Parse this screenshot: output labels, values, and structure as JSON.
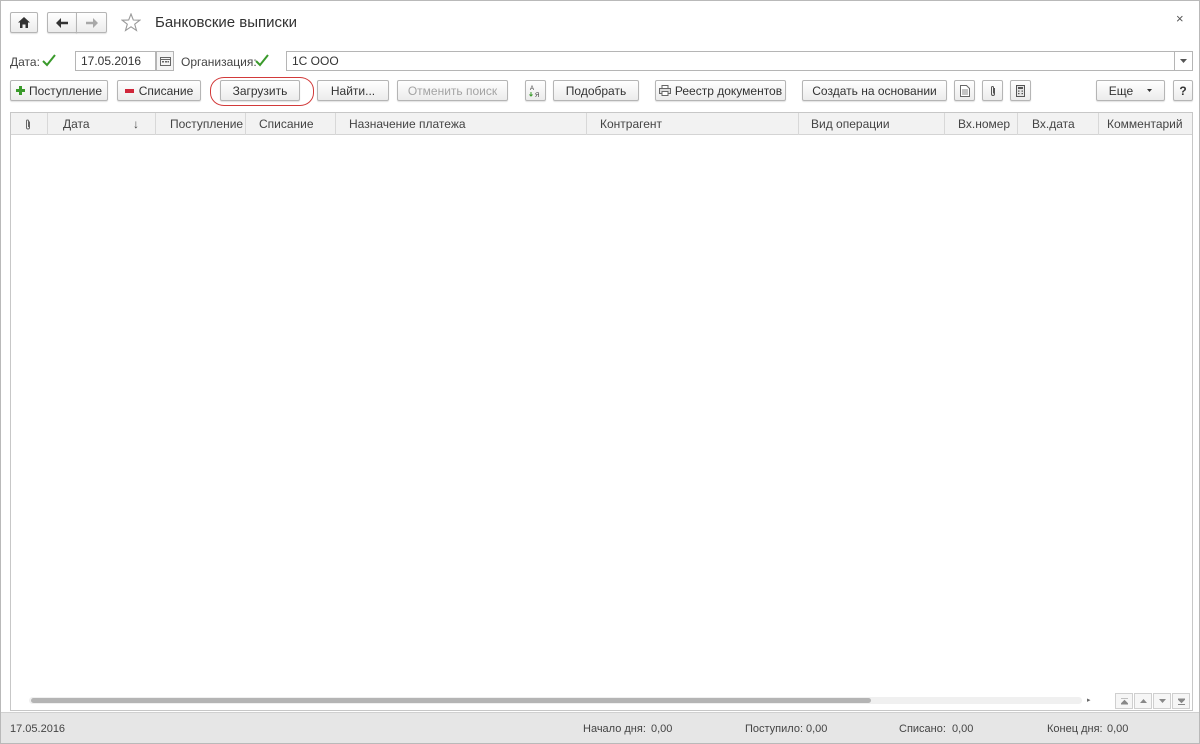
{
  "header": {
    "title": "Банковские выписки",
    "close_symbol": "×"
  },
  "filters": {
    "date_label": "Дата:",
    "date_value": "17.05.2016",
    "org_label": "Организация:",
    "org_value": "1С ООО"
  },
  "toolbar": {
    "income_label": "Поступление",
    "writeoff_label": "Списание",
    "load_label": "Загрузить",
    "find_label": "Найти...",
    "cancel_search_label": "Отменить поиск",
    "select_label": "Подобрать",
    "registry_label": "Реестр документов",
    "create_based_label": "Создать на основании",
    "more_label": "Еще",
    "help_label": "?"
  },
  "table": {
    "columns": [
      {
        "label": ""
      },
      {
        "label": "Дата"
      },
      {
        "label": "Поступление"
      },
      {
        "label": "Списание"
      },
      {
        "label": "Назначение платежа"
      },
      {
        "label": "Контрагент"
      },
      {
        "label": "Вид операции"
      },
      {
        "label": "Вх.номер"
      },
      {
        "label": "Вх.дата"
      },
      {
        "label": "Комментарий"
      }
    ],
    "sort_arrow": "↓",
    "rows": []
  },
  "status": {
    "date": "17.05.2016",
    "start_label": "Начало дня:",
    "start_value": "0,00",
    "income_label": "Поступило:",
    "income_value": "0,00",
    "writeoff_label": "Списано:",
    "writeoff_value": "0,00",
    "end_label": "Конец дня:",
    "end_value": "0,00"
  },
  "colors": {
    "accent_green": "#3a9a2b",
    "minus_red": "#d0263a",
    "highlight_red": "#d23a3a"
  }
}
